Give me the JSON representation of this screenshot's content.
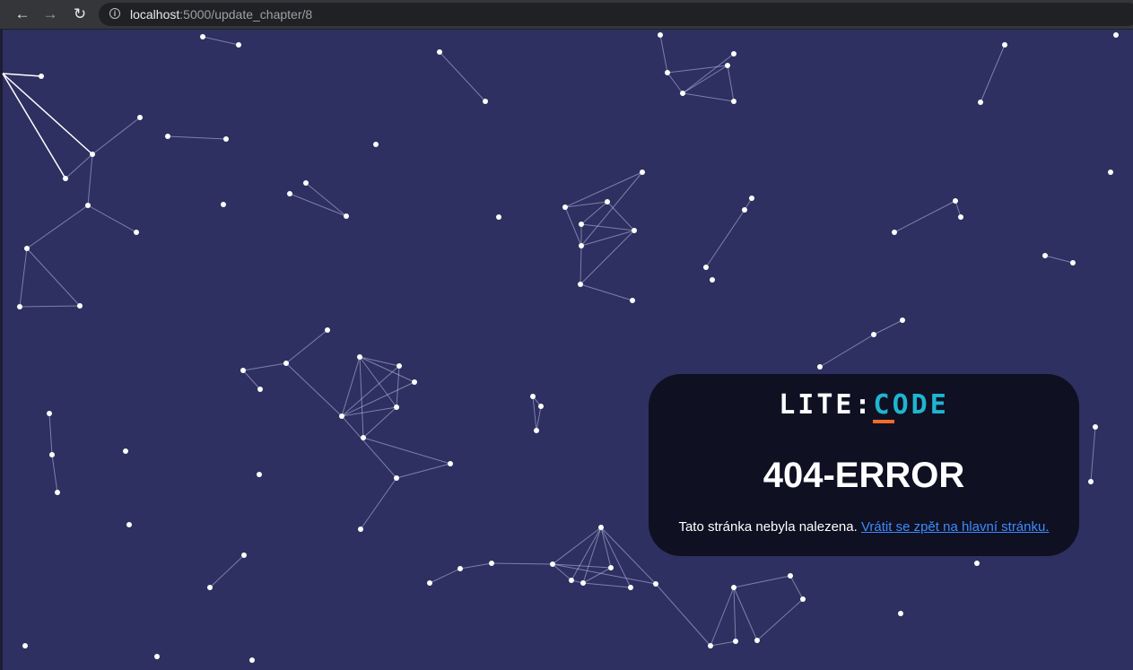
{
  "browser": {
    "url_host": "localhost",
    "url_path": ":5000/update_chapter/8"
  },
  "card": {
    "logo_left": "LITE",
    "logo_colon": ":",
    "logo_right": "CODE",
    "title": "404-ERROR",
    "message": "Tato stránka nebyla nalezena.",
    "link_text": "Vrátit se zpět na hlavní stránku."
  },
  "colors": {
    "background": "#2d3060",
    "card": "#0f1022",
    "logo_accent": "#1fb5d1",
    "logo_underline": "#f26b2a",
    "link": "#3d8bfd"
  }
}
